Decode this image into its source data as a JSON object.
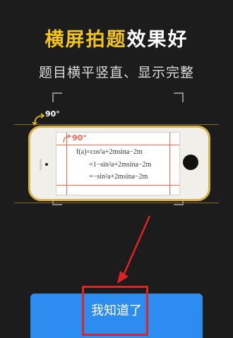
{
  "header": {
    "title_gold": "横屏拍题",
    "title_white": "效果好",
    "subtitle": "题目横平竖直、显示完整"
  },
  "illustration": {
    "rotate_label_outer": "90°",
    "rotate_label_inner": "90°",
    "formula_line1": "f(a)=cos²a+2msina−2m",
    "formula_line2": "=1−sin²a+2msina−2m",
    "formula_line3": "=−sin²a+2msina−2m",
    "accent_gold": "#f2c318",
    "accent_red": "#e02222"
  },
  "actions": {
    "confirm_label": "我知道了",
    "button_color": "#2d8cf0"
  }
}
